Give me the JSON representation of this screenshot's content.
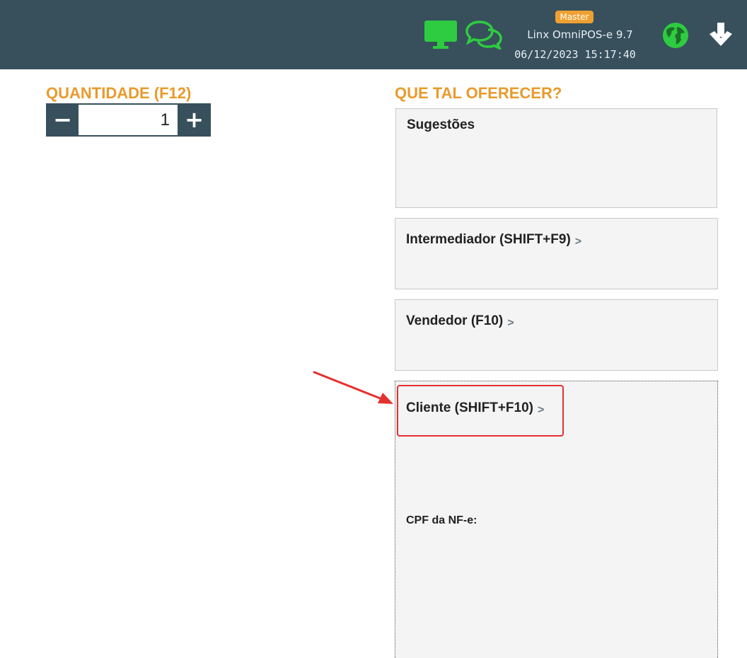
{
  "header": {
    "badge": "Master",
    "app_name": "Linx OmniPOS-e  9.7",
    "datetime": "06/12/2023 15:17:40",
    "icons": [
      "monitor-icon",
      "chat-icon",
      "globe-icon",
      "arrow-down-icon"
    ],
    "icon_color": "#2ecc40",
    "background": "#37505c"
  },
  "quantity": {
    "title": "QUANTIDADE (F12)",
    "value": "1",
    "minus_icon": "minus-icon",
    "plus_icon": "plus-icon"
  },
  "offer": {
    "title": "QUE TAL OFERECER?",
    "suggestions_label": "Sugestões",
    "intermediador_label": "Intermediador (SHIFT+F9)",
    "vendedor_label": "Vendedor (F10)",
    "cliente_label": "Cliente (SHIFT+F10)",
    "cpf_label": "CPF da NF-e:"
  },
  "colors": {
    "accent": "#e99a2c",
    "highlight": "#e53030"
  }
}
